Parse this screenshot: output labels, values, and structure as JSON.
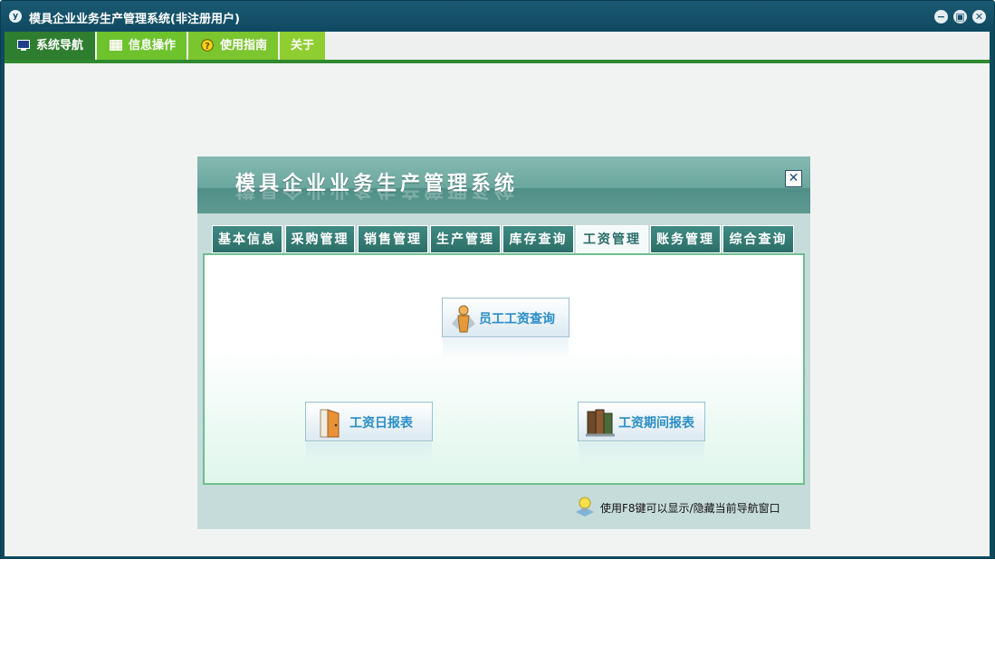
{
  "window": {
    "title": "模具企业业务生产管理系统(非注册用户)",
    "logo_glyph": "y",
    "controls": [
      {
        "name": "minimize-icon",
        "glyph": "−"
      },
      {
        "name": "restore-icon",
        "glyph": "▣"
      },
      {
        "name": "close-icon",
        "glyph": "✕"
      }
    ]
  },
  "menubar": {
    "items": [
      {
        "label": "系统导航",
        "icon": "monitor-icon",
        "bg": "#2f7d2f"
      },
      {
        "label": "信息操作",
        "icon": "grid-icon",
        "bg": "#6ec32c"
      },
      {
        "label": "使用指南",
        "icon": "help-icon",
        "bg": "#7bc52e"
      },
      {
        "label": "关于",
        "icon": "",
        "bg": "#8fce30"
      }
    ]
  },
  "panel": {
    "title": "模具企业业务生产管理系统",
    "close_glyph": "✕",
    "tabs": [
      {
        "label": "基本信息",
        "active": false
      },
      {
        "label": "采购管理",
        "active": false
      },
      {
        "label": "销售管理",
        "active": false
      },
      {
        "label": "生产管理",
        "active": false
      },
      {
        "label": "库存查询",
        "active": false
      },
      {
        "label": "工资管理",
        "active": true
      },
      {
        "label": "账务管理",
        "active": false
      },
      {
        "label": "综合查询",
        "active": false
      }
    ],
    "functions": {
      "employee_salary_query": "员工工资查询",
      "daily_salary_report": "工资日报表",
      "period_salary_report": "工资期间报表"
    },
    "hint": "使用F8键可以显示/隐藏当前导航窗口"
  },
  "colors": {
    "accent_green": "#2f8a2f",
    "panel_teal": "#6aa79e",
    "link_blue": "#2a8ec9"
  }
}
